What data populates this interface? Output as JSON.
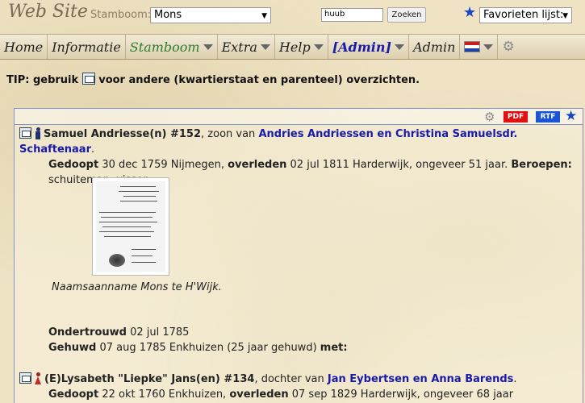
{
  "header": {
    "site_title": "Web Site",
    "stamboom_label": "Stamboom:",
    "tree_selected": "Mons",
    "search_value": "huub",
    "search_button": "Zoeken",
    "favorites_selected": "Favorieten lijst:"
  },
  "nav": {
    "home": "Home",
    "informatie": "Informatie",
    "stamboom": "Stamboom",
    "extra": "Extra",
    "help": "Help",
    "admin_bracket": "[Admin]",
    "admin": "Admin"
  },
  "tip": {
    "prefix": "TIP: gebruik",
    "suffix": "voor andere (kwartierstaat en parenteel) overzichten."
  },
  "toolbar": {
    "pdf": "PDF",
    "rtf": "RTF"
  },
  "person1": {
    "name": "Samuel Andriesse(n) #152",
    "relation": ", zoon van ",
    "parents": "Andries Andriessen en Christina Samuelsdr. Schaftenaar",
    "period": ".",
    "baptized_label": "Gedoopt",
    "baptized_text": " 30 dec 1759 Nijmegen, ",
    "died_label": "overleden",
    "died_text": " 02 jul 1811 Harderwijk, ongeveer 51 jaar. ",
    "occupations_label": "Beroepen:",
    "occupations": "schuiteman, visser",
    "caption": "Naamsaanname Mons te H'Wijk.",
    "betrothed_label": "Ondertrouwd",
    "betrothed_text": " 02 jul 1785",
    "married_label": "Gehuwd",
    "married_text": " 07 aug 1785 Enkhuizen (25 jaar gehuwd) ",
    "with_label": "met:"
  },
  "person2": {
    "name": "(E)Lysabeth \"Liepke\" Jans(en) #134",
    "relation": ", dochter van ",
    "parents": "Jan Eybertsen en Anna Barends",
    "period": ".",
    "baptized_label": "Gedoopt",
    "baptized_text": " 22 okt 1760 Enkhuizen, ",
    "died_label": "overleden",
    "died_text": " 07 sep 1829 Harderwijk, ongeveer 68 jaar"
  }
}
